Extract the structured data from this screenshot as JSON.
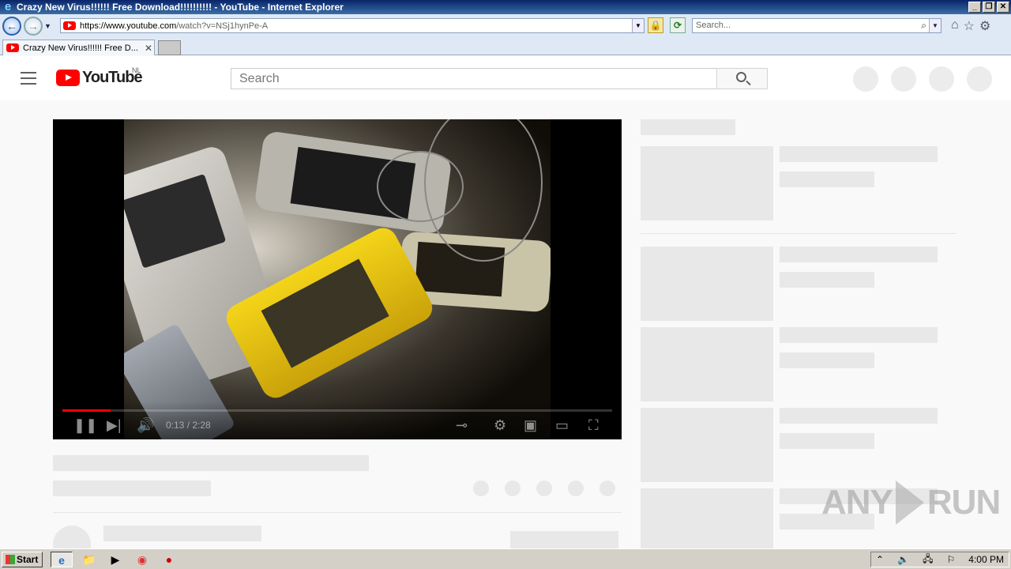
{
  "window": {
    "title": "Crazy New Virus!!!!!! Free Download!!!!!!!!!! - YouTube - Internet Explorer",
    "controls": {
      "minimize": "_",
      "restore": "❐",
      "close": "✕"
    }
  },
  "toolbar": {
    "back_icon": "←",
    "forward_icon": "→",
    "url_host": "https://www.youtube.com",
    "url_path": "/watch?v=NSj1hynPe-A",
    "search_placeholder": "Search..."
  },
  "tab": {
    "title": "Crazy New Virus!!!!!! Free D...",
    "close": "✕"
  },
  "masthead": {
    "logo_text": "YouTube",
    "region": "NL",
    "search_placeholder": "Search"
  },
  "player": {
    "time": "0:13 / 2:28",
    "progress": 0.088
  },
  "watermark": {
    "left": "ANY",
    "right": "RUN"
  },
  "taskbar": {
    "start_label": "Start",
    "clock": "4:00 PM"
  }
}
